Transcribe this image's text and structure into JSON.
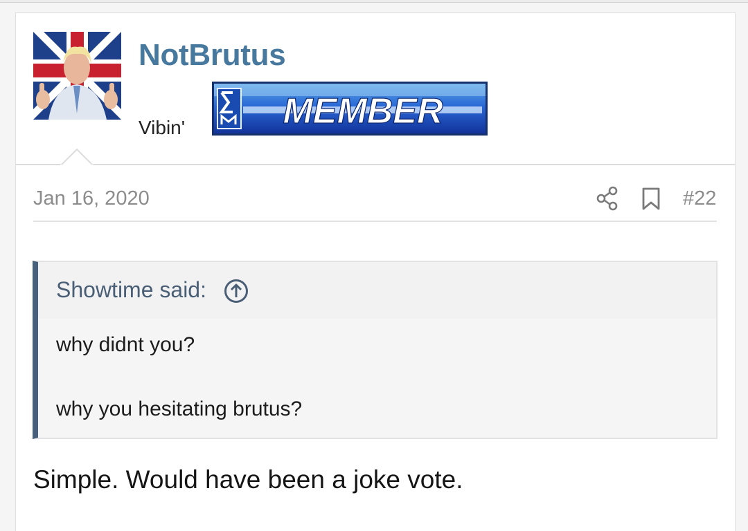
{
  "post": {
    "username": "NotBrutus",
    "user_title": "Vibin'",
    "banner_text": "MEMBER",
    "date": "Jan 16, 2020",
    "post_number": "#22",
    "quote": {
      "author": "Showtime said:",
      "lines": [
        "why didnt you?",
        "why you hesitating brutus?"
      ]
    },
    "message": "Simple. Would have been a joke vote."
  },
  "icons": [
    "share-icon",
    "bookmark-icon",
    "arrow-up-circle-icon"
  ],
  "colors": {
    "username": "#47799f",
    "quote_border": "#47607c",
    "meta_text": "#8c8c8c",
    "banner_blue": "#1f4fc4"
  }
}
